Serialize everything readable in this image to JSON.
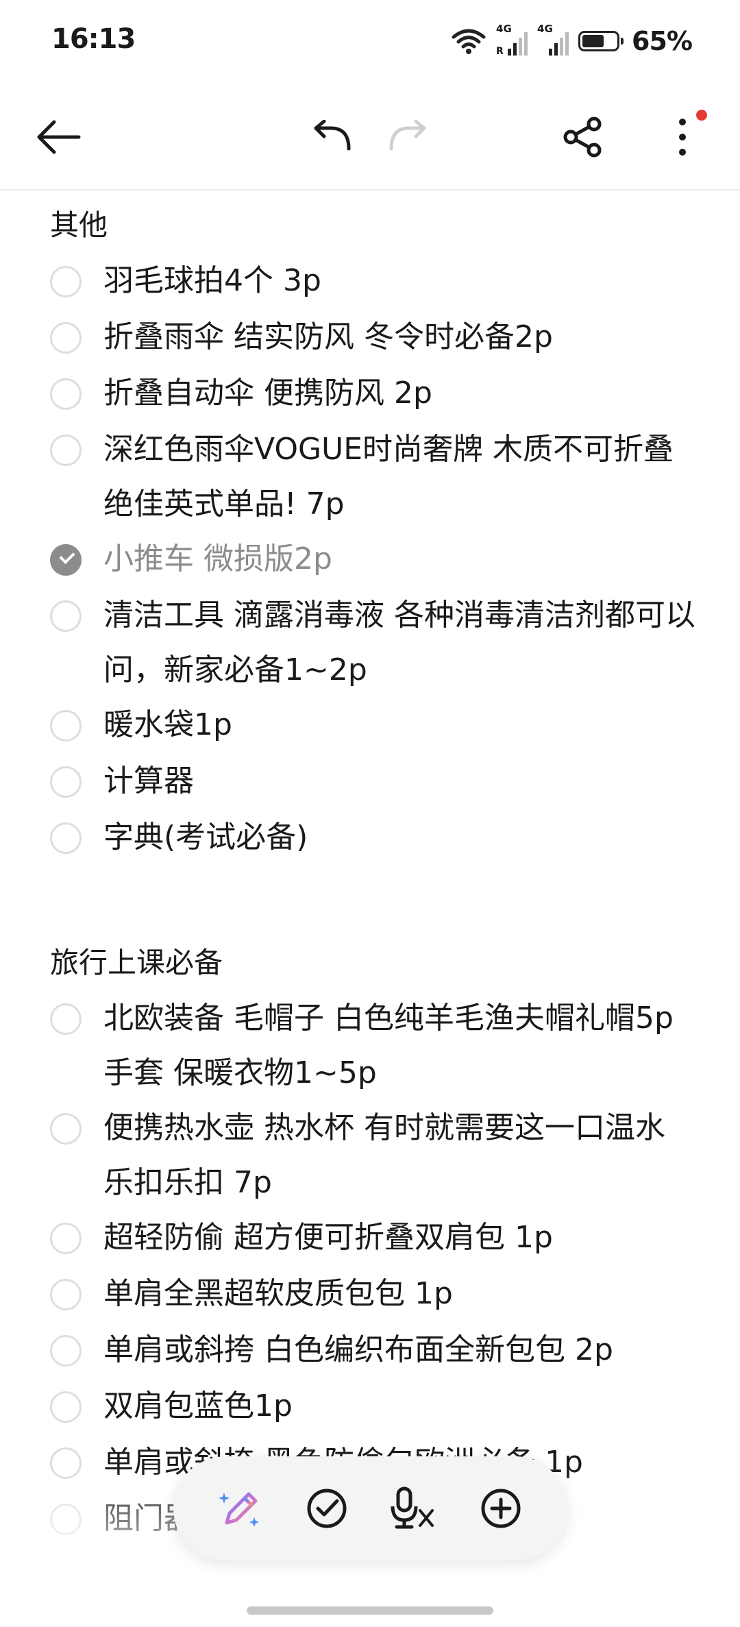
{
  "status_bar": {
    "time": "16:13",
    "network1": "4G",
    "roaming": "R",
    "network2": "4G",
    "battery_percent": "65%",
    "battery_level": 0.65
  },
  "toolbar": {
    "icons": [
      "back-arrow-icon",
      "undo-icon",
      "redo-icon",
      "share-icon",
      "more-icon"
    ],
    "notification_dot_color": "#e53935"
  },
  "sections": [
    {
      "title": "其他",
      "items": [
        {
          "text": "羽毛球拍4个 3p",
          "checked": false
        },
        {
          "text": "折叠雨伞 结实防风 冬令时必备2p",
          "checked": false
        },
        {
          "text": "折叠自动伞 便携防风 2p",
          "checked": false
        },
        {
          "text": "深红色雨伞VOGUE时尚奢牌 木质不可折叠 绝佳英式单品! 7p",
          "checked": false
        },
        {
          "text": "小推车 微损版2p",
          "checked": true
        },
        {
          "text": "清洁工具 滴露消毒液 各种消毒清洁剂都可以问，新家必备1~2p",
          "checked": false
        },
        {
          "text": "暖水袋1p",
          "checked": false
        },
        {
          "text": "计算器",
          "checked": false
        },
        {
          "text": "字典(考试必备)",
          "checked": false
        }
      ]
    },
    {
      "title": "旅行上课必备",
      "items": [
        {
          "text": "北欧装备 毛帽子 白色纯羊毛渔夫帽礼帽5p 手套 保暖衣物1~5p",
          "checked": false
        },
        {
          "text": "便携热水壶 热水杯 有时就需要这一口温水 乐扣乐扣 7p",
          "checked": false
        },
        {
          "text": "超轻防偷 超方便可折叠双肩包 1p",
          "checked": false
        },
        {
          "text": "单肩全黑超软皮质包包 1p",
          "checked": false
        },
        {
          "text": "单肩或斜挎 白色编织布面全新包包 2p",
          "checked": false
        },
        {
          "text": "双肩包蓝色1p",
          "checked": false
        },
        {
          "text": "单肩或斜挎 黑色防偷包欧洲必备 1p",
          "checked": false
        },
        {
          "text": "阻门器",
          "checked": false
        }
      ]
    }
  ],
  "floating_bar": {
    "icons": [
      "ai-pen-icon",
      "checklist-icon",
      "voice-to-text-icon",
      "add-icon"
    ],
    "ai_gradient": [
      "#4f8ef7",
      "#c86dd7",
      "#f0a35e"
    ]
  }
}
